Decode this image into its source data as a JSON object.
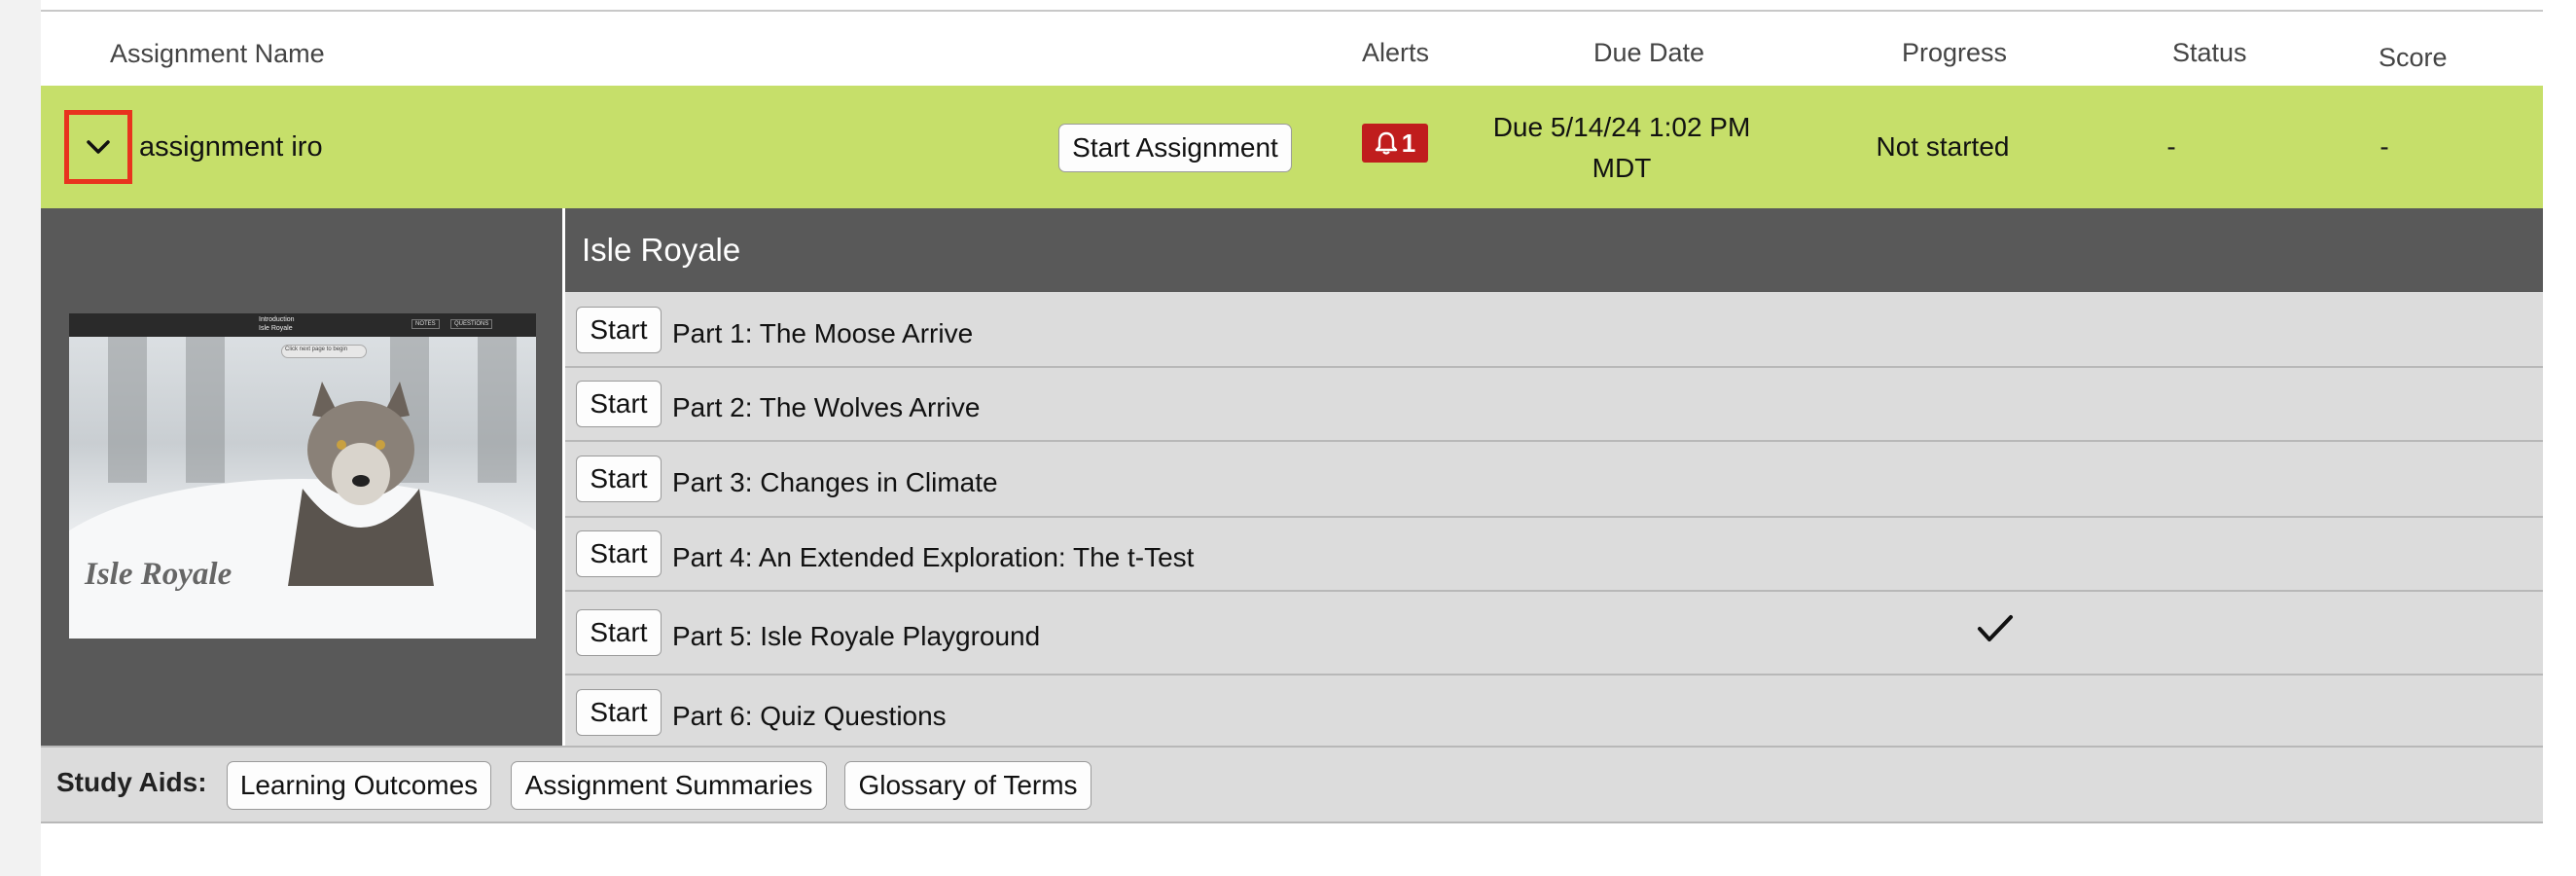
{
  "header": {
    "assignment_name": "Assignment Name",
    "alerts": "Alerts",
    "due_date": "Due Date",
    "progress": "Progress",
    "status": "Status",
    "score": "Score"
  },
  "assignment": {
    "name": "assignment iro",
    "start_button": "Start Assignment",
    "alert_count": "1",
    "due_line1": "Due 5/14/24 1:02 PM",
    "due_line2": "MDT",
    "progress": "Not started",
    "status": "-",
    "score": "-",
    "row_color": "#c6df6a",
    "alert_color": "#c01d1d",
    "expand_icon": "chevron-down-icon"
  },
  "module": {
    "title": "Isle Royale",
    "thumbnail_caption": "Isle Royale",
    "thumbnail_header": "Introduction",
    "thumbnail_subheader": "Isle Royale",
    "thumbnail_buttons": [
      "NOTES",
      "QUESTIONS"
    ],
    "thumbnail_tooltip": "Click next page to begin",
    "start_label": "Start",
    "parts": [
      {
        "label": "Part 1: The Moose Arrive",
        "completed": false
      },
      {
        "label": "Part 2: The Wolves Arrive",
        "completed": false
      },
      {
        "label": "Part 3: Changes in Climate",
        "completed": false
      },
      {
        "label": "Part 4: An Extended Exploration: The t-Test",
        "completed": false
      },
      {
        "label": "Part 5: Isle Royale Playground",
        "completed": true
      },
      {
        "label": "Part 6: Quiz Questions",
        "completed": false
      }
    ]
  },
  "study_aids": {
    "label": "Study Aids:",
    "buttons": [
      "Learning Outcomes",
      "Assignment Summaries",
      "Glossary of Terms"
    ]
  }
}
